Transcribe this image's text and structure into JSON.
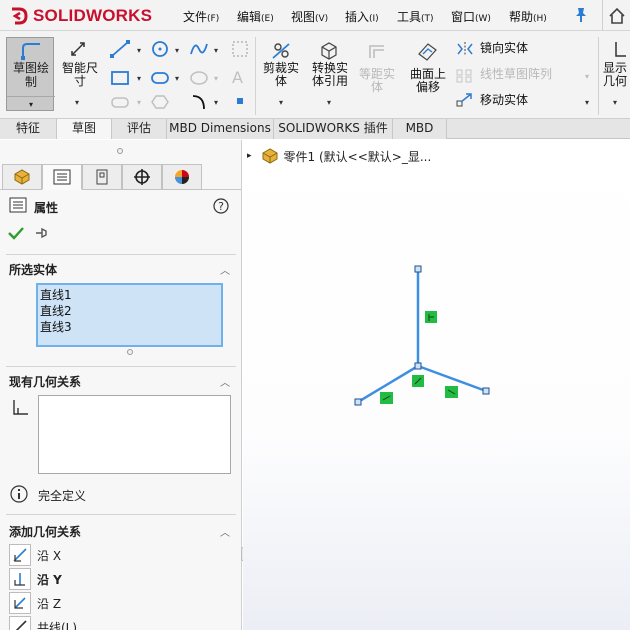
{
  "app": {
    "brand": "SOLIDWORKS"
  },
  "menu": [
    {
      "label": "文件",
      "key": "(F)"
    },
    {
      "label": "编辑",
      "key": "(E)"
    },
    {
      "label": "视图",
      "key": "(V)"
    },
    {
      "label": "插入",
      "key": "(I)"
    },
    {
      "label": "工具",
      "key": "(T)"
    },
    {
      "label": "窗口",
      "key": "(W)"
    },
    {
      "label": "帮助",
      "key": "(H)"
    }
  ],
  "ribbon": {
    "sketch": "草图绘\n制",
    "smart_dim": "智能尺\n寸",
    "trim": "剪裁实\n体",
    "convert": "转换实\n体引用",
    "offset": "等距实\n体",
    "surface_offset": "曲面上\n偏移",
    "mirror": "镜向实体",
    "linear_pattern": "线性草图阵列",
    "move": "移动实体",
    "display": "显示\n几何"
  },
  "tabs": [
    "特征",
    "草图",
    "评估",
    "MBD Dimensions",
    "SOLIDWORKS 插件",
    "MBD"
  ],
  "active_tab": "草图",
  "tree": {
    "root": "零件1  (默认<<默认>_显..."
  },
  "panel": {
    "title": "属性",
    "selected_section": "所选实体",
    "selected_items": [
      "直线1",
      "直线2",
      "直线3"
    ],
    "existing_section": "现有几何关系",
    "status": "完全定义",
    "add_section": "添加几何关系",
    "add_items": [
      {
        "label": "沿 X",
        "bold": false
      },
      {
        "label": "沿 Y",
        "bold": true
      },
      {
        "label": "沿 Z",
        "bold": false
      },
      {
        "label": "共线(L)",
        "bold": false
      }
    ]
  },
  "colors": {
    "accent_red": "#c8102e",
    "sketch_line": "#3f8fe0",
    "relation_marker": "#22bb44",
    "selection_fill": "#cfe3f7",
    "selection_border": "#6fb2ea"
  }
}
